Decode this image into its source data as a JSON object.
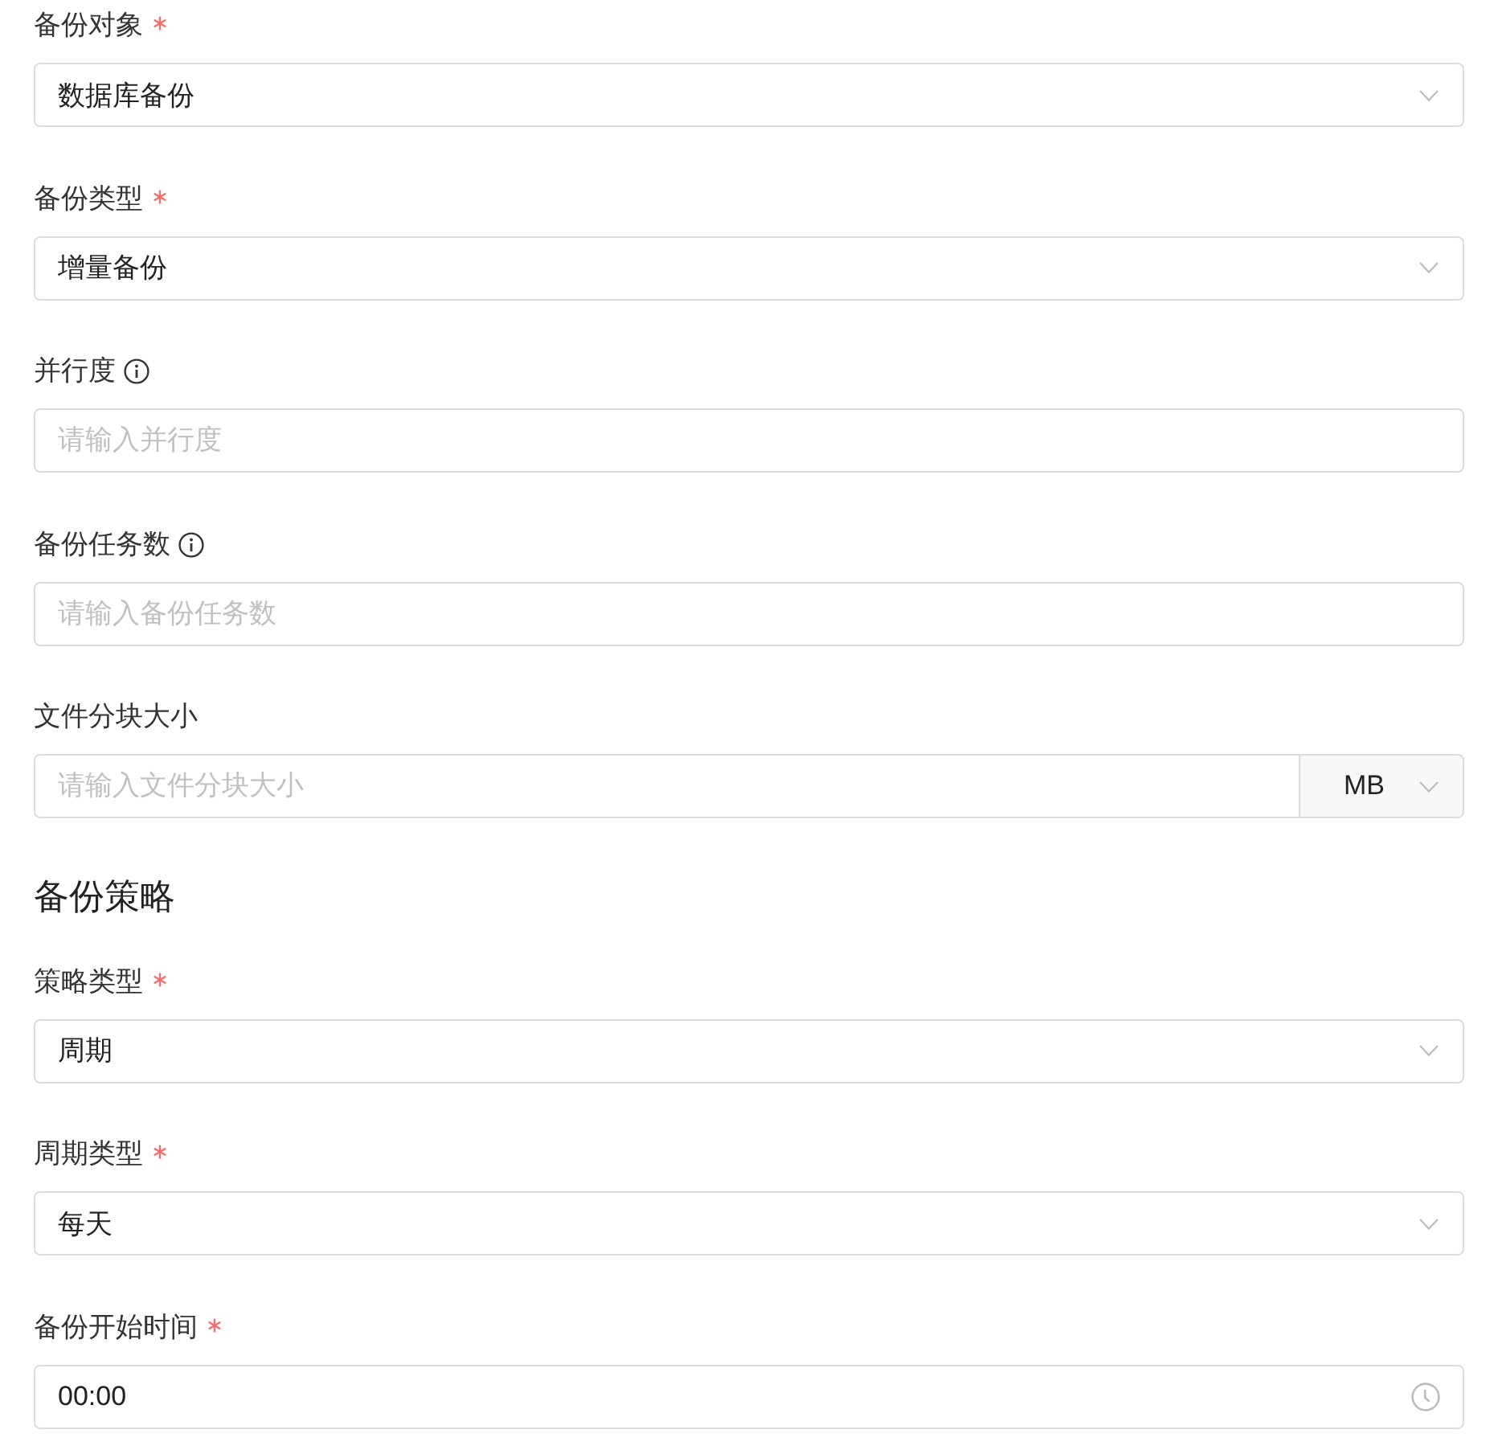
{
  "basic_fields": [
    {
      "kind": "select",
      "label": "备份对象",
      "required": true,
      "info": false,
      "value": "数据库备份"
    },
    {
      "kind": "select",
      "label": "备份类型",
      "required": true,
      "info": false,
      "value": "增量备份"
    },
    {
      "kind": "input",
      "label": "并行度",
      "required": false,
      "info": true,
      "placeholder": "请输入并行度"
    },
    {
      "kind": "input",
      "label": "备份任务数",
      "required": false,
      "info": true,
      "placeholder": "请输入备份任务数"
    },
    {
      "kind": "input_unit",
      "label": "文件分块大小",
      "required": false,
      "info": false,
      "placeholder": "请输入文件分块大小",
      "unit": "MB"
    }
  ],
  "strategy_section": {
    "title": "备份策略",
    "fields": [
      {
        "kind": "select",
        "label": "策略类型",
        "required": true,
        "info": false,
        "value": "周期"
      },
      {
        "kind": "select",
        "label": "周期类型",
        "required": true,
        "info": false,
        "value": "每天"
      },
      {
        "kind": "time",
        "label": "备份开始时间",
        "required": true,
        "info": false,
        "value": "00:00"
      }
    ]
  }
}
